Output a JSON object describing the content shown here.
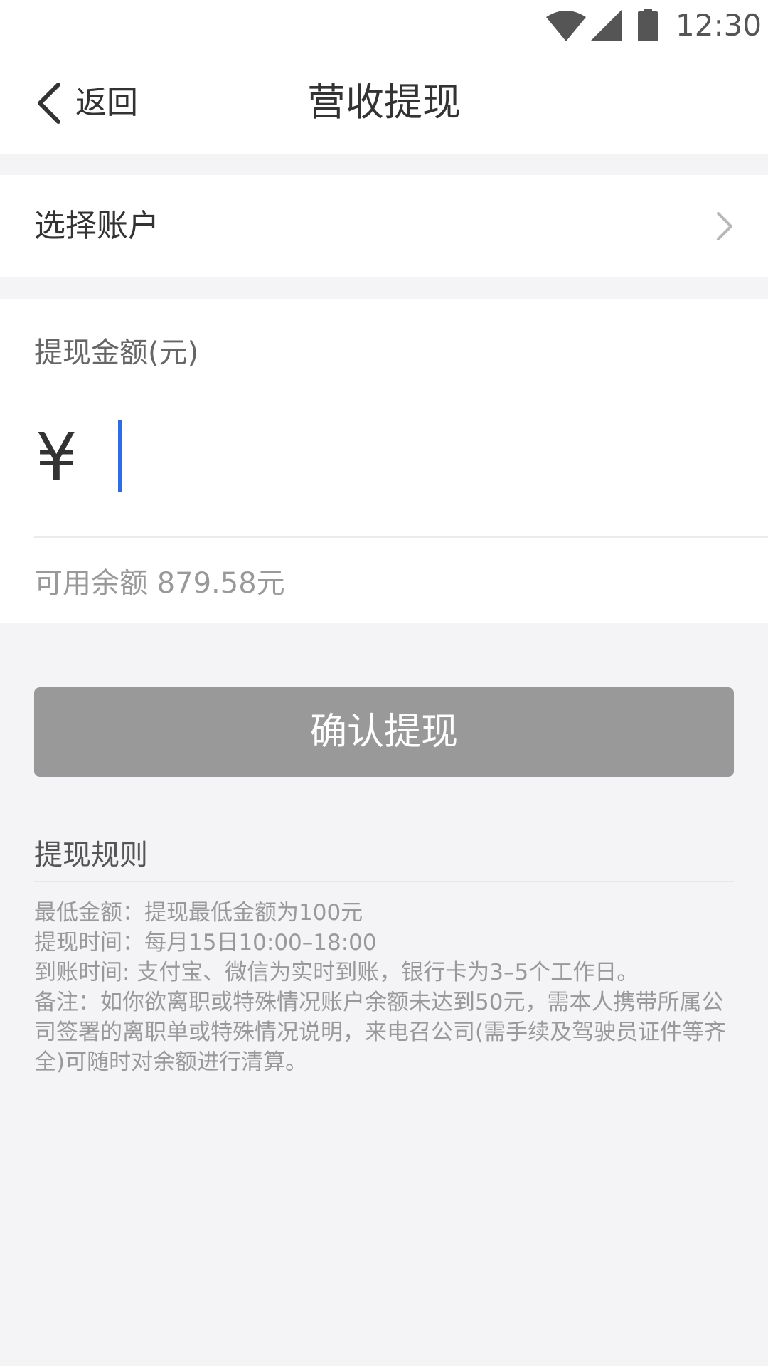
{
  "status_bar": {
    "time": "12:30",
    "icons": [
      "wifi-icon",
      "signal-icon",
      "battery-icon"
    ]
  },
  "nav": {
    "back_label": "返回",
    "title": "营收提现"
  },
  "account": {
    "label": "选择账户"
  },
  "amount": {
    "label": "提现金额(元)",
    "currency_symbol": "¥",
    "value": "",
    "balance_text": "可用余额 879.58元"
  },
  "confirm": {
    "label": "确认提现",
    "color": "#999999"
  },
  "rules": {
    "title": "提现规则",
    "lines": [
      "最低金额：提现最低金额为100元",
      "提现时间：每月15日10:00–18:00",
      "到账时间: 支付宝、微信为实时到账，银行卡为3–5个工作日。",
      "备注：如你欲离职或特殊情况账户余额未达到50元，需本人携带所属公司签署的离职单或特殊情况说明，来电召公司(需手续及驾驶员证件等齐全)可随时对余额进行清算。"
    ]
  },
  "colors": {
    "accent_cursor": "#2b6de6",
    "background": "#f4f4f7"
  }
}
